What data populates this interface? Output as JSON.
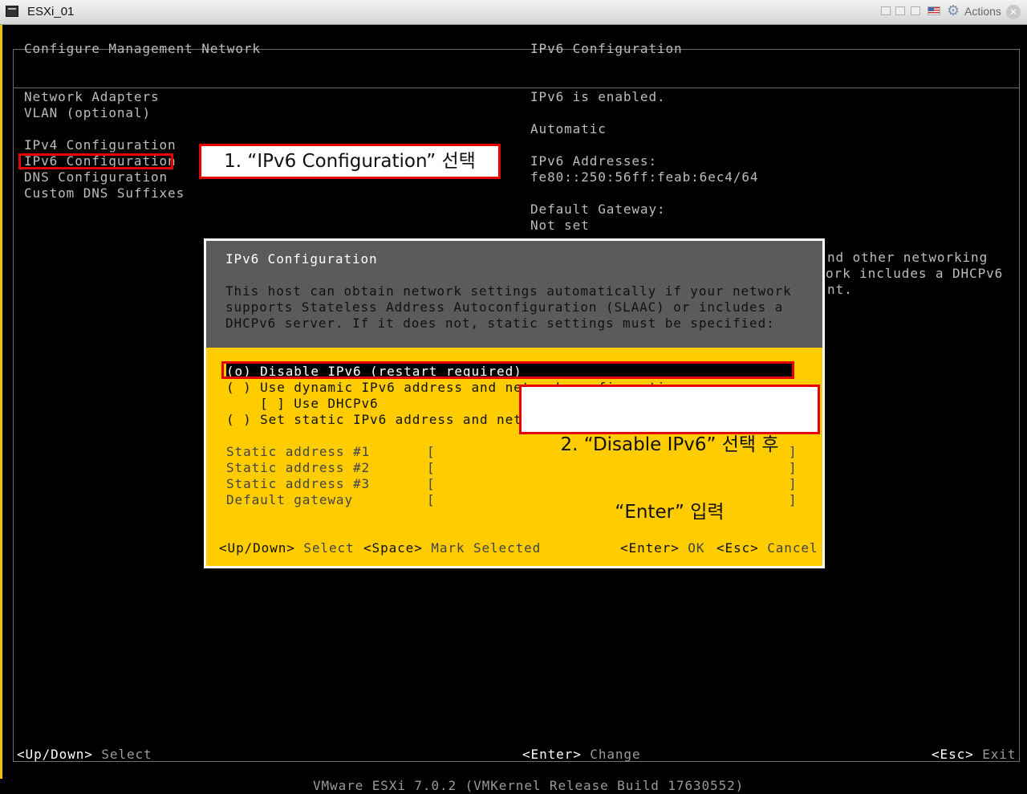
{
  "window": {
    "title": "ESXi_01",
    "actions_label": "Actions",
    "close_glyph": "✕",
    "gear_glyph": "⚙"
  },
  "screen": {
    "left_header": "Configure Management Network",
    "right_header": "IPv6 Configuration",
    "menu": [
      "Network Adapters",
      "VLAN (optional)",
      "IPv4 Configuration",
      "IPv6 Configuration",
      "DNS Configuration",
      "Custom DNS Suffixes"
    ],
    "info": {
      "status": "IPv6 is enabled.",
      "mode": "Automatic",
      "addresses_label": "IPv6 Addresses:",
      "address": "fe80::250:56ff:feab:6ec4/64",
      "gateway_label": "Default Gateway:",
      "gateway_value": "Not set",
      "partial_1": "nd other networking",
      "partial_2": "ork includes a DHCPv6",
      "partial_3": "nt."
    },
    "footer": {
      "select_key": "<Up/Down>",
      "select_label": "Select",
      "change_key": "<Enter>",
      "change_label": "Change",
      "exit_key": "<Esc>",
      "exit_label": "Exit"
    },
    "bottom_line": "VMware ESXi 7.0.2 (VMKernel Release Build 17630552)"
  },
  "dialog": {
    "title": "IPv6 Configuration",
    "description": [
      "This host can obtain network settings automatically if your network",
      "supports Stateless Address Autoconfiguration (SLAAC) or includes a",
      "DHCPv6 server. If it does not, static settings must be specified:"
    ],
    "options": [
      "(o) Disable IPv6 (restart required)",
      "( ) Use dynamic IPv6 address and network configuration",
      "    [ ] Use DHCPv6",
      "( ) Set static IPv6 address and network configuration:"
    ],
    "fields": [
      {
        "label": "Static address #1",
        "open": "[",
        "close": "]"
      },
      {
        "label": "Static address #2",
        "open": "[",
        "close": "]"
      },
      {
        "label": "Static address #3",
        "open": "[",
        "close": "]"
      },
      {
        "label": "Default gateway",
        "open": "[",
        "close": "]"
      }
    ],
    "keys": {
      "updown_key": "<Up/Down>",
      "updown_label": "Select",
      "space_key": "<Space>",
      "space_label": "Mark Selected",
      "enter_key": "<Enter>",
      "enter_label": "OK",
      "esc_key": "<Esc>",
      "esc_label": "Cancel"
    }
  },
  "annotations": {
    "step1": "1. “IPv6 Configuration” 선택",
    "step2_line1": "2. “Disable IPv6” 선택 후",
    "step2_line2": "“Enter” 입력"
  },
  "colors": {
    "dialog_bg": "#ffcc00",
    "dialog_header": "#5b5b5b",
    "highlight": "#e60000",
    "console_text": "#bcbcbc"
  }
}
